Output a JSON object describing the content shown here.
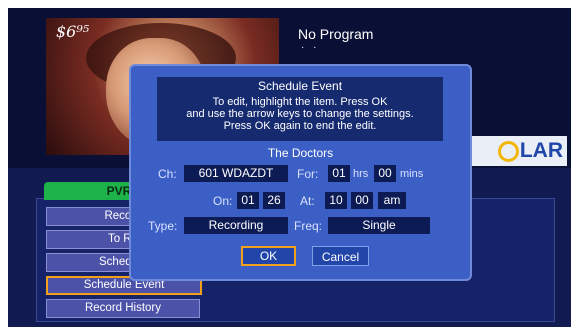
{
  "now_playing": {
    "channel_logo": "$6⁹⁵",
    "program_title": "No Program",
    "program_subtitle": "· ·"
  },
  "brand": {
    "text_left": "",
    "text_right": "LAR"
  },
  "pvr_menu": {
    "tab_label": "PVR",
    "items": [
      {
        "label": "Record"
      },
      {
        "label": "To Re"
      },
      {
        "label": "Schedule"
      },
      {
        "label": "Schedule Event",
        "selected": true
      },
      {
        "label": "Record History"
      }
    ]
  },
  "dialog": {
    "title": "Schedule Event",
    "instructions": [
      "To edit, highlight the item. Press OK",
      "and use the arrow keys to change the settings.",
      "Press OK again to end the edit."
    ],
    "program_name": "The Doctors",
    "fields": {
      "channel_label": "Ch:",
      "channel_value": "601 WDAZDT",
      "for_label": "For:",
      "hours_value": "01",
      "hours_unit": "hrs",
      "minutes_value": "00",
      "minutes_unit": "mins",
      "on_label": "On:",
      "month_value": "01",
      "day_value": "26",
      "at_label": "At:",
      "hour_value": "10",
      "minute_value": "00",
      "ampm_value": "am",
      "type_label": "Type:",
      "type_value": "Recording",
      "freq_label": "Freq:",
      "freq_value": "Single"
    },
    "ok_label": "OK",
    "cancel_label": "Cancel"
  },
  "colors": {
    "focus": "#f3a11b",
    "dialog": "#3b5fc4",
    "pvr_tab": "#1eb34a"
  }
}
